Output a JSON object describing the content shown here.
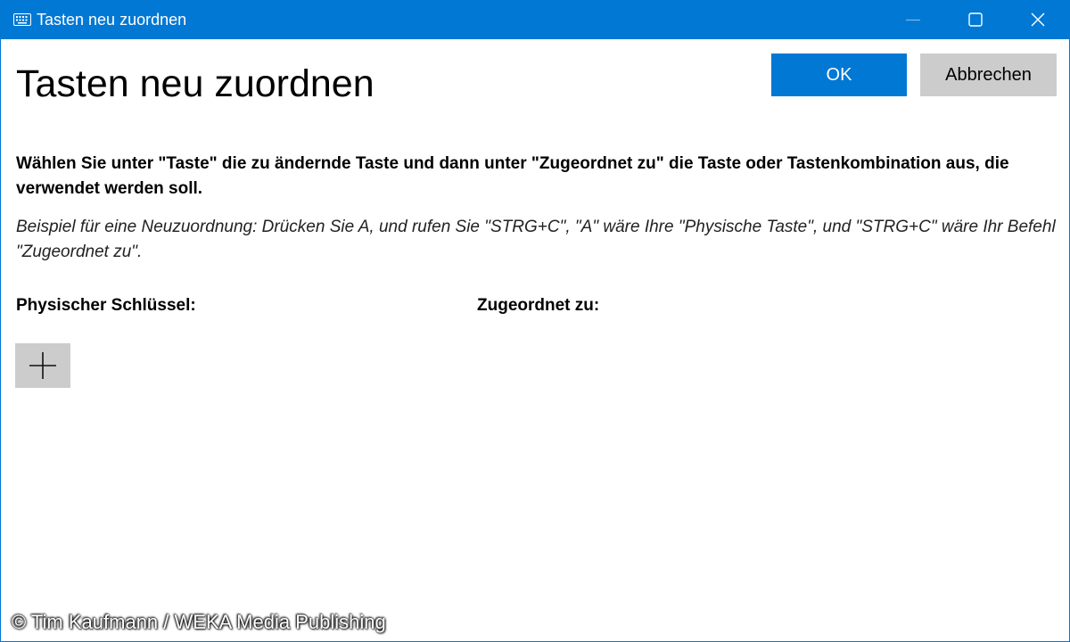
{
  "window": {
    "title": "Tasten neu zuordnen",
    "accent_color": "#0078d4",
    "icons": {
      "app": "keyboard-icon",
      "minimize": "minimize-icon",
      "maximize": "maximize-icon",
      "close": "close-icon"
    }
  },
  "header": {
    "heading": "Tasten neu zuordnen",
    "ok_label": "OK",
    "cancel_label": "Abbrechen"
  },
  "content": {
    "instruction": "Wählen Sie unter \"Taste\" die zu ändernde Taste und dann unter \"Zugeordnet zu\" die Taste oder Tastenkombination aus, die verwendet werden soll.",
    "example": "Beispiel für eine Neuzuordnung: Drücken Sie A, und rufen Sie \"STRG+C\", \"A\" wäre Ihre \"Physische Taste\", und \"STRG+C\" wäre Ihr Befehl \"Zugeordnet zu\".",
    "physical_key_label": "Physischer Schlüssel:",
    "mapped_to_label": "Zugeordnet zu:",
    "add_icon": "plus-icon"
  },
  "credit": "© Tim Kaufmann / WEKA Media Publishing"
}
